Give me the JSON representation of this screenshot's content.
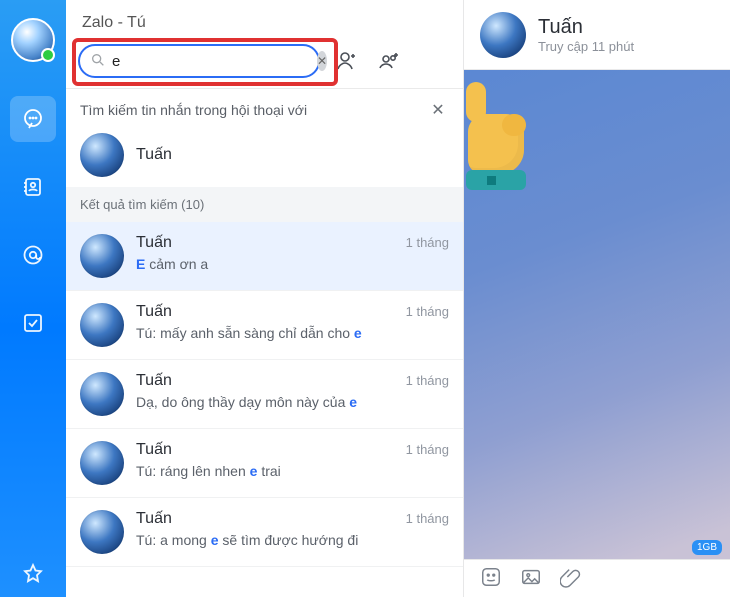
{
  "app_title": "Zalo - Tú",
  "search": {
    "value": "e",
    "placeholder": ""
  },
  "colors": {
    "accent": "#2b6cf5",
    "highlight_border": "#e03131"
  },
  "suggest": {
    "heading": "Tìm kiếm tin nhắn trong hội thoại với",
    "person_name": "Tuấn"
  },
  "results_header": "Kết quả tìm kiếm (10)",
  "highlight_term": "e",
  "results": [
    {
      "name": "Tuấn",
      "time": "1 tháng",
      "msg_prefix": "",
      "msg_hl": "E",
      "msg_suffix": " cảm ơn a",
      "selected": true
    },
    {
      "name": "Tuấn",
      "time": "1 tháng",
      "msg_prefix": "Tú: mấy anh sẵn sàng chỉ dẫn cho ",
      "msg_hl": "e",
      "msg_suffix": ""
    },
    {
      "name": "Tuấn",
      "time": "1 tháng",
      "msg_prefix": "Dạ, do ông thầy dạy môn này của ",
      "msg_hl": "e",
      "msg_suffix": ""
    },
    {
      "name": "Tuấn",
      "time": "1 tháng",
      "msg_prefix": "Tú: ráng lên nhen ",
      "msg_hl": "e",
      "msg_suffix": " trai"
    },
    {
      "name": "Tuấn",
      "time": "1 tháng",
      "msg_prefix": "Tú: a mong ",
      "msg_hl": "e",
      "msg_suffix": " sẽ tìm được hướng đi"
    }
  ],
  "chat": {
    "title": "Tuấn",
    "subtitle": "Truy cập 11 phút",
    "badge": "1GB"
  },
  "rail_icons": [
    "chat-icon",
    "contacts-icon",
    "mention-icon",
    "check-icon",
    "star-icon"
  ]
}
